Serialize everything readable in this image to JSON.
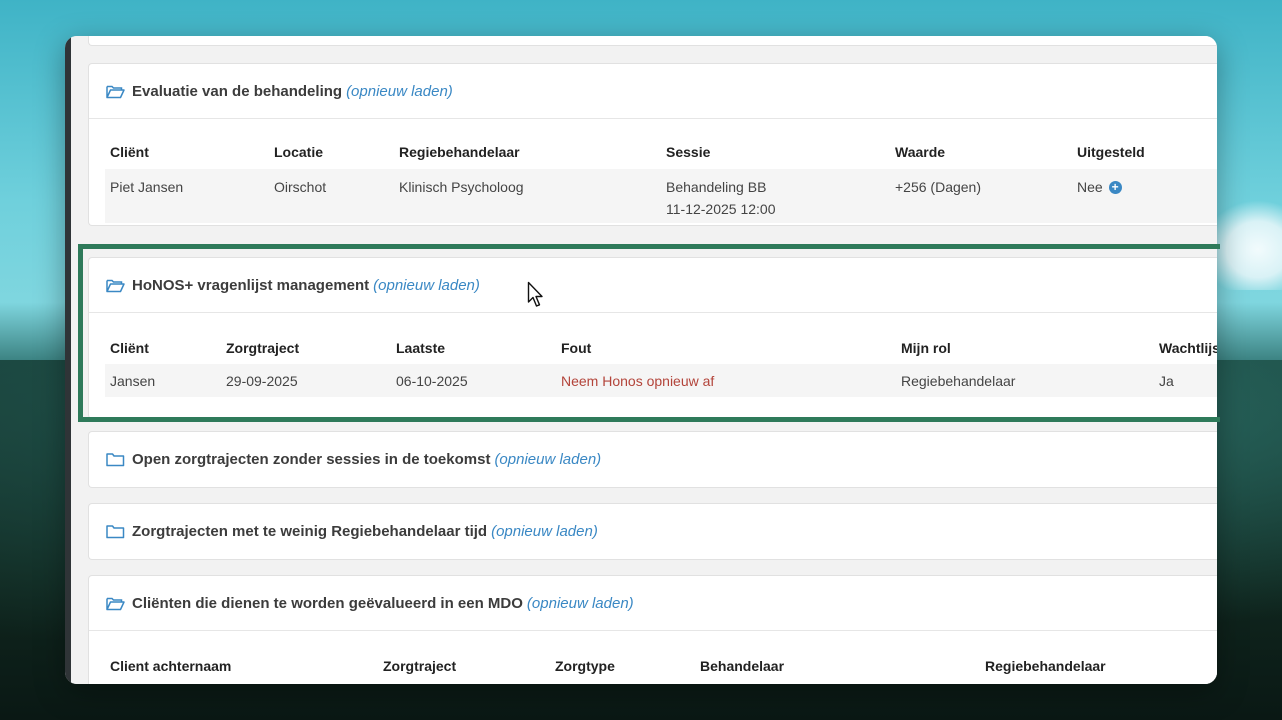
{
  "panels": {
    "evaluatie": {
      "title": "Evaluatie van de behandeling",
      "reload": "(opnieuw laden)",
      "headers": [
        "Cliënt",
        "Locatie",
        "Regiebehandelaar",
        "Sessie",
        "Waarde",
        "Uitgesteld"
      ],
      "row": {
        "client": "Piet Jansen",
        "locatie": "Oirschot",
        "regiebehandelaar": "Klinisch Psycholoog",
        "sessie_line1": "Behandeling BB",
        "sessie_line2": "11-12-2025 12:00",
        "waarde": "+256 (Dagen)",
        "uitgesteld": "Nee"
      }
    },
    "honos": {
      "title": "HoNOS+ vragenlijst management",
      "reload": "(opnieuw laden)",
      "headers": [
        "Cliënt",
        "Zorgtraject",
        "Laatste",
        "Fout",
        "Mijn rol",
        "Wachtlijst"
      ],
      "row": {
        "client": "Jansen",
        "zorgtraject": "29-09-2025",
        "laatste": "06-10-2025",
        "fout": "Neem Honos opnieuw af",
        "mijn_rol": "Regiebehandelaar",
        "wachtlijst": "Ja"
      }
    },
    "open": {
      "title": "Open zorgtrajecten zonder sessies in de toekomst",
      "reload": "(opnieuw laden)"
    },
    "weinig": {
      "title": "Zorgtrajecten met te weinig Regiebehandelaar tijd",
      "reload": "(opnieuw laden)"
    },
    "mdo": {
      "title": "Cliënten die dienen te worden geëvalueerd in een MDO",
      "reload": "(opnieuw laden)",
      "headers": [
        "Client achternaam",
        "Zorgtraject",
        "Zorgtype",
        "Behandelaar",
        "Regiebehandelaar"
      ]
    }
  },
  "colors": {
    "link": "#3a88c4",
    "error": "#b3443a",
    "highlight": "#2e7a5a"
  },
  "icons": {
    "folder_open": "folder-open-icon",
    "folder": "folder-icon",
    "plus_circle": "plus-circle-icon",
    "cursor": "mouse-pointer-icon"
  }
}
